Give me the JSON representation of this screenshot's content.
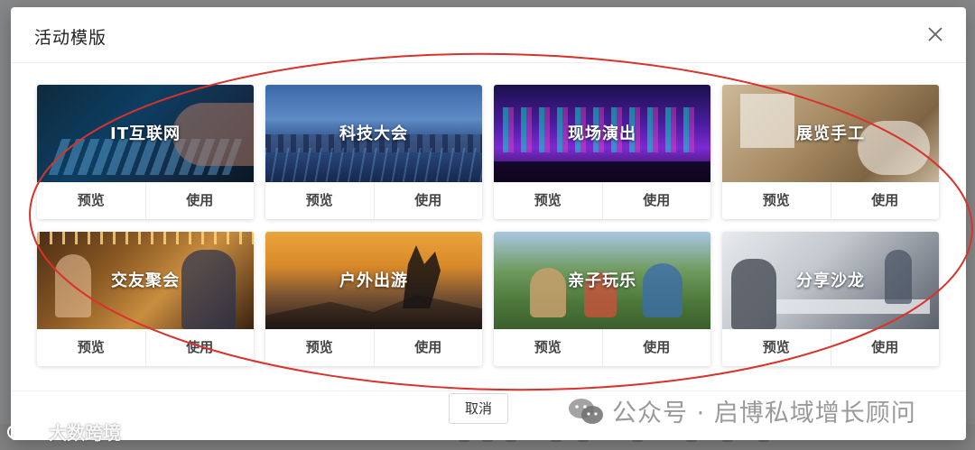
{
  "modal": {
    "title": "活动模版",
    "cancel_label": "取消"
  },
  "cards": [
    {
      "label": "IT互联网",
      "preview": "预览",
      "use": "使用"
    },
    {
      "label": "科技大会",
      "preview": "预览",
      "use": "使用"
    },
    {
      "label": "现场演出",
      "preview": "预览",
      "use": "使用"
    },
    {
      "label": "展览手工",
      "preview": "预览",
      "use": "使用"
    },
    {
      "label": "交友聚会",
      "preview": "预览",
      "use": "使用"
    },
    {
      "label": "户外出游",
      "preview": "预览",
      "use": "使用"
    },
    {
      "label": "亲子玩乐",
      "preview": "预览",
      "use": "使用"
    },
    {
      "label": "分享沙龙",
      "preview": "预览",
      "use": "使用"
    }
  ],
  "watermarks": {
    "left": "大数跨境",
    "right": "公众号 · 启博私域增长顾问"
  },
  "colors": {
    "annotation_ellipse": "#d9322b",
    "overlay": "rgba(0,0,0,0.45)"
  },
  "icons": {
    "close": "close-icon",
    "wechat": "wechat-icon"
  }
}
